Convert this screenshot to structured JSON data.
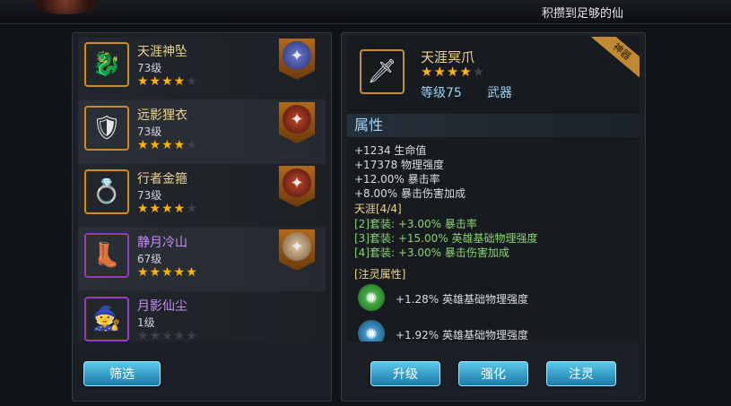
{
  "header": {
    "notice": "积攒到足够的仙"
  },
  "equipment_list": [
    {
      "name": "天涯神坠",
      "level": "73级",
      "stars": 4,
      "max_stars": 5,
      "quality": "legend",
      "icon": "pendant-icon",
      "owner_icon": "hero-avatar-icon"
    },
    {
      "name": "远影狸衣",
      "level": "73级",
      "stars": 4,
      "max_stars": 5,
      "quality": "legend",
      "icon": "armor-icon",
      "owner_icon": "hero-avatar-icon"
    },
    {
      "name": "行者金箍",
      "level": "73级",
      "stars": 4,
      "max_stars": 5,
      "quality": "legend",
      "icon": "circlet-icon",
      "owner_icon": "hero-avatar-icon"
    },
    {
      "name": "静月冷山",
      "level": "67级",
      "stars": 5,
      "max_stars": 5,
      "quality": "epic",
      "icon": "boots-icon",
      "owner_icon": "hero-avatar-icon"
    },
    {
      "name": "月影仙尘",
      "level": "1级",
      "stars": 0,
      "max_stars": 5,
      "quality": "epic",
      "icon": "cloak-icon",
      "owner_icon": null
    }
  ],
  "filter_button": "筛选",
  "detail": {
    "ribbon": "神器",
    "name": "天涯冥爪",
    "stars": 4,
    "max_stars": 5,
    "level": "等级75",
    "type": "武器",
    "section_title": "属性",
    "stats": [
      "+1234 生命值",
      "+17378 物理强度",
      "+12.00% 暴击率",
      "+8.00% 暴击伤害加成"
    ],
    "set_title": "天涯[4/4]",
    "set_bonuses": [
      "[2]套装: +3.00% 暴击率",
      "[3]套装: +15.00% 英雄基础物理强度",
      "[4]套装: +3.00% 暴击伤害加成"
    ],
    "injection_title": "[注灵属性]",
    "injections": [
      {
        "text": "+1.28% 英雄基础物理强度",
        "color": "#2f8f2f"
      },
      {
        "text": "+1.92% 英雄基础物理强度",
        "color": "#1f6fa8"
      }
    ]
  },
  "actions": {
    "upgrade": "升级",
    "enhance": "强化",
    "inject": "注灵"
  },
  "colors": {
    "legend_border": "#c88d2a",
    "epic_border": "#8d3fc1",
    "button": "#1b7aa8",
    "star": "#ffb400"
  }
}
